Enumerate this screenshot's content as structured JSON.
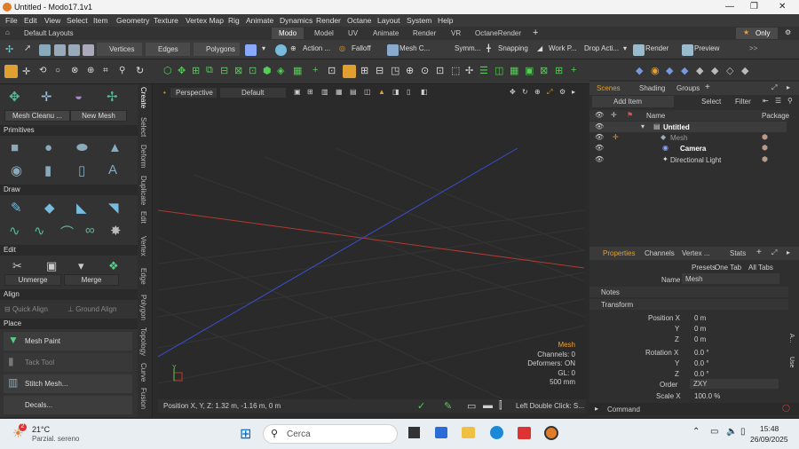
{
  "window": {
    "title": "Untitled - Modo17.1v1",
    "minimize": "—",
    "maximize": "❐",
    "close": "✕"
  },
  "menu": [
    "File",
    "Edit",
    "View",
    "Select",
    "Item",
    "Geometry",
    "Texture",
    "Vertex Map",
    "Rig",
    "Animate",
    "Dynamics",
    "Render",
    "Octane",
    "Layout",
    "System",
    "Help"
  ],
  "layout": {
    "name": "Default Layouts",
    "tabs": [
      "Modo",
      "Model",
      "UV",
      "Animate",
      "Render",
      "VR",
      "OctaneRender"
    ],
    "only": "Only"
  },
  "toolbar1": {
    "vertices": "Vertices",
    "edges": "Edges",
    "polygons": "Polygons",
    "action": "Action ...",
    "falloff": "Falloff",
    "mesh": "Mesh C...",
    "symm": "Symm...",
    "snapping": "Snapping",
    "work": "Work P...",
    "drop": "Drop Acti...",
    "render": "Render",
    "preview": "Preview"
  },
  "left": {
    "tabs": [
      "Create",
      "Select",
      "Deform",
      "Duplicate",
      "Edit",
      "Vertex",
      "Edge",
      "Polygon",
      "Topology",
      "Curve",
      "Fusion"
    ],
    "mesh_cleanup": "Mesh Cleanu ...",
    "new_mesh": "New Mesh",
    "sections": {
      "primitives": "Primitives",
      "draw": "Draw",
      "edit": "Edit",
      "align": "Align",
      "place": "Place"
    },
    "unmerge": "Unmerge",
    "merge": "Merge",
    "quick_align": "Quick Align",
    "ground_align": "Ground Align",
    "mesh_paint": "Mesh Paint",
    "tack_tool": "Tack Tool",
    "stitch_mesh": "Stitch Mesh...",
    "decals": "Decals..."
  },
  "viewport": {
    "view": "Perspective",
    "shading": "Default",
    "info": {
      "item": "Mesh",
      "channels": "Channels: 0",
      "deformers": "Deformers: ON",
      "gl": "GL: 0",
      "scale": "500 mm"
    },
    "axis_y": "Y"
  },
  "status": {
    "position": "Position X, Y, Z:   1.32 m, -1.16 m, 0 m",
    "hint": "Left Double Click: S..."
  },
  "scenes": {
    "tabs": [
      "Scenes",
      "Shading",
      "Groups"
    ],
    "add_item": "Add Item",
    "select": "Select",
    "filter": "Filter",
    "col_name": "Name",
    "col_package": "Package",
    "items": [
      "Untitled",
      "Mesh",
      "Camera",
      "Directional Light"
    ]
  },
  "properties": {
    "tabs": [
      "Properties",
      "Channels",
      "Vertex ...",
      "Stats"
    ],
    "presets": "Presets",
    "one_tab": "One Tab",
    "all_tabs": "All Tabs",
    "name_label": "Name",
    "name_value": "Mesh",
    "notes": "Notes",
    "transform": "Transform",
    "position_label": "Position X",
    "rotation_label": "Rotation X",
    "y": "Y",
    "z": "Z",
    "pos": [
      "0 m",
      "0 m",
      "0 m"
    ],
    "rot": [
      "0.0 °",
      "0.0 °",
      "0.0 °"
    ],
    "order_label": "Order",
    "order_value": "ZXY",
    "scale_label": "Scale X",
    "scale_value": "100.0 %"
  },
  "right_vtabs": [
    "A...",
    "Use"
  ],
  "command": "Command",
  "taskbar": {
    "temp": "21°C",
    "weather": "Parzial. sereno",
    "badge": "2",
    "search": "Cerca",
    "time": "15:48",
    "date": "26/09/2025"
  },
  "colors": {
    "accent": "#f0a030",
    "x_axis": "#c0392b",
    "z_axis": "#3a4fd0",
    "win_blue": "#0067c0"
  }
}
